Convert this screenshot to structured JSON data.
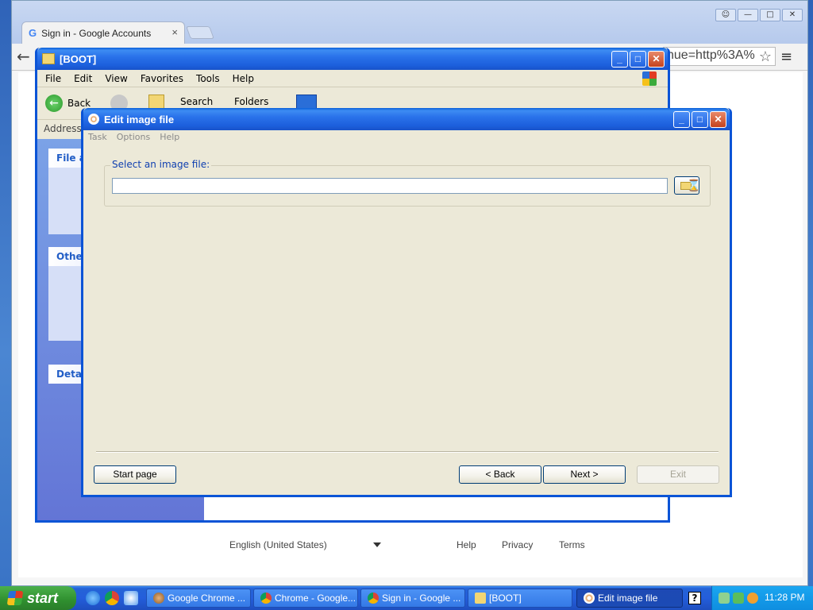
{
  "chrome": {
    "tab_title": "Sign in - Google Accounts",
    "tab_close": "×",
    "window_buttons": [
      "☺",
      "—",
      "□",
      "✕"
    ],
    "back_glyph": "←",
    "omnibox_text": "nue=http%3A%",
    "star": "☆",
    "menu": "≡",
    "footer": {
      "language": "English (United States)",
      "help": "Help",
      "privacy": "Privacy",
      "terms": "Terms"
    }
  },
  "explorer": {
    "title": "[BOOT]",
    "menu": [
      "File",
      "Edit",
      "View",
      "Favorites",
      "Tools",
      "Help"
    ],
    "toolbar": {
      "back": "Back",
      "search": "Search",
      "folders": "Folders"
    },
    "address_label": "Address",
    "task_boxes": [
      "File a",
      "Othe",
      "Deta"
    ]
  },
  "dialog": {
    "title": "Edit image file",
    "menu": [
      "Task",
      "Options",
      "Help"
    ],
    "select_label": "Select an image file:",
    "path_value": "",
    "buttons": {
      "start_page": "Start page",
      "back": "< Back",
      "next": "Next >",
      "exit": "Exit"
    }
  },
  "window_controls": {
    "minimize": "_",
    "maximize": "□",
    "close": "✕"
  },
  "taskbar": {
    "start": "start",
    "tasks": [
      "Google Chrome ...",
      "Chrome - Google...",
      "Sign in - Google ...",
      "[BOOT]",
      "Edit image file"
    ],
    "help_icon": "?",
    "clock": "11:28 PM"
  }
}
